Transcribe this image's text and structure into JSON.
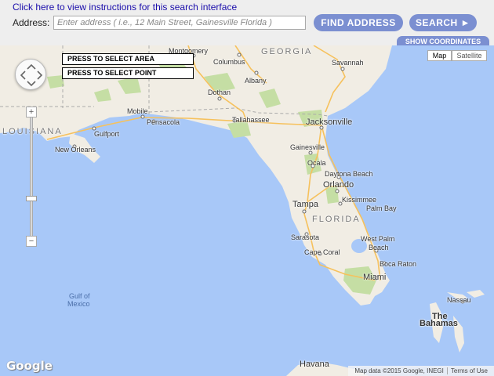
{
  "header": {
    "help_link": "Click here to view instructions for this search interface",
    "address_label": "Address:",
    "address_placeholder": "Enter address ( i.e., 12 Main Street, Gainesville Florida )",
    "address_value": "",
    "find_address_button": "FIND ADDRESS",
    "search_button": "SEARCH ►",
    "show_coordinates_button": "SHOW COORDINATES"
  },
  "map": {
    "select_area_button": "PRESS TO SELECT AREA",
    "select_point_button": "PRESS TO SELECT POINT",
    "zoom_in": "+",
    "zoom_out": "−",
    "map_type": {
      "map": "Map",
      "satellite": "Satellite",
      "selected": "Map"
    },
    "logo": "Google",
    "attribution": "Map data ©2015 Google, INEGI",
    "terms": "Terms of Use",
    "colors": {
      "water": "#a8c8f8",
      "land": "#f1ede4",
      "green": "#c5dea4",
      "road_major": "#f6c15c"
    },
    "labels": {
      "georgia": "GEORGIA",
      "louisiana": "LOUISIANA",
      "florida": "FLORIDA",
      "montgomery": "Montgomery",
      "columbus": "Columbus",
      "savannah": "Savannah",
      "albany": "Albany",
      "dothan": "Dothan",
      "mobile": "Mobile",
      "pensacola": "Pensacola",
      "tallahassee": "Tallahassee",
      "jacksonville": "Jacksonville",
      "gulfport": "Gulfport",
      "new_orleans": "New Orleans",
      "gainesville": "Gainesville",
      "ocala": "Ocala",
      "daytona_beach": "Daytona Beach",
      "orlando": "Orlando",
      "kissimmee": "Kissimmee",
      "palm_bay": "Palm Bay",
      "tampa": "Tampa",
      "sarasota": "Sarasota",
      "cape_coral": "Cape Coral",
      "west_palm_beach_1": "West Palm",
      "west_palm_beach_2": "Beach",
      "boca_raton": "Boca Raton",
      "miami": "Miami",
      "nassau": "Nassau",
      "the_bahamas_1": "The",
      "the_bahamas_2": "Bahamas",
      "gulf_1": "Gulf of",
      "gulf_2": "Mexico",
      "havana": "Havana"
    }
  }
}
